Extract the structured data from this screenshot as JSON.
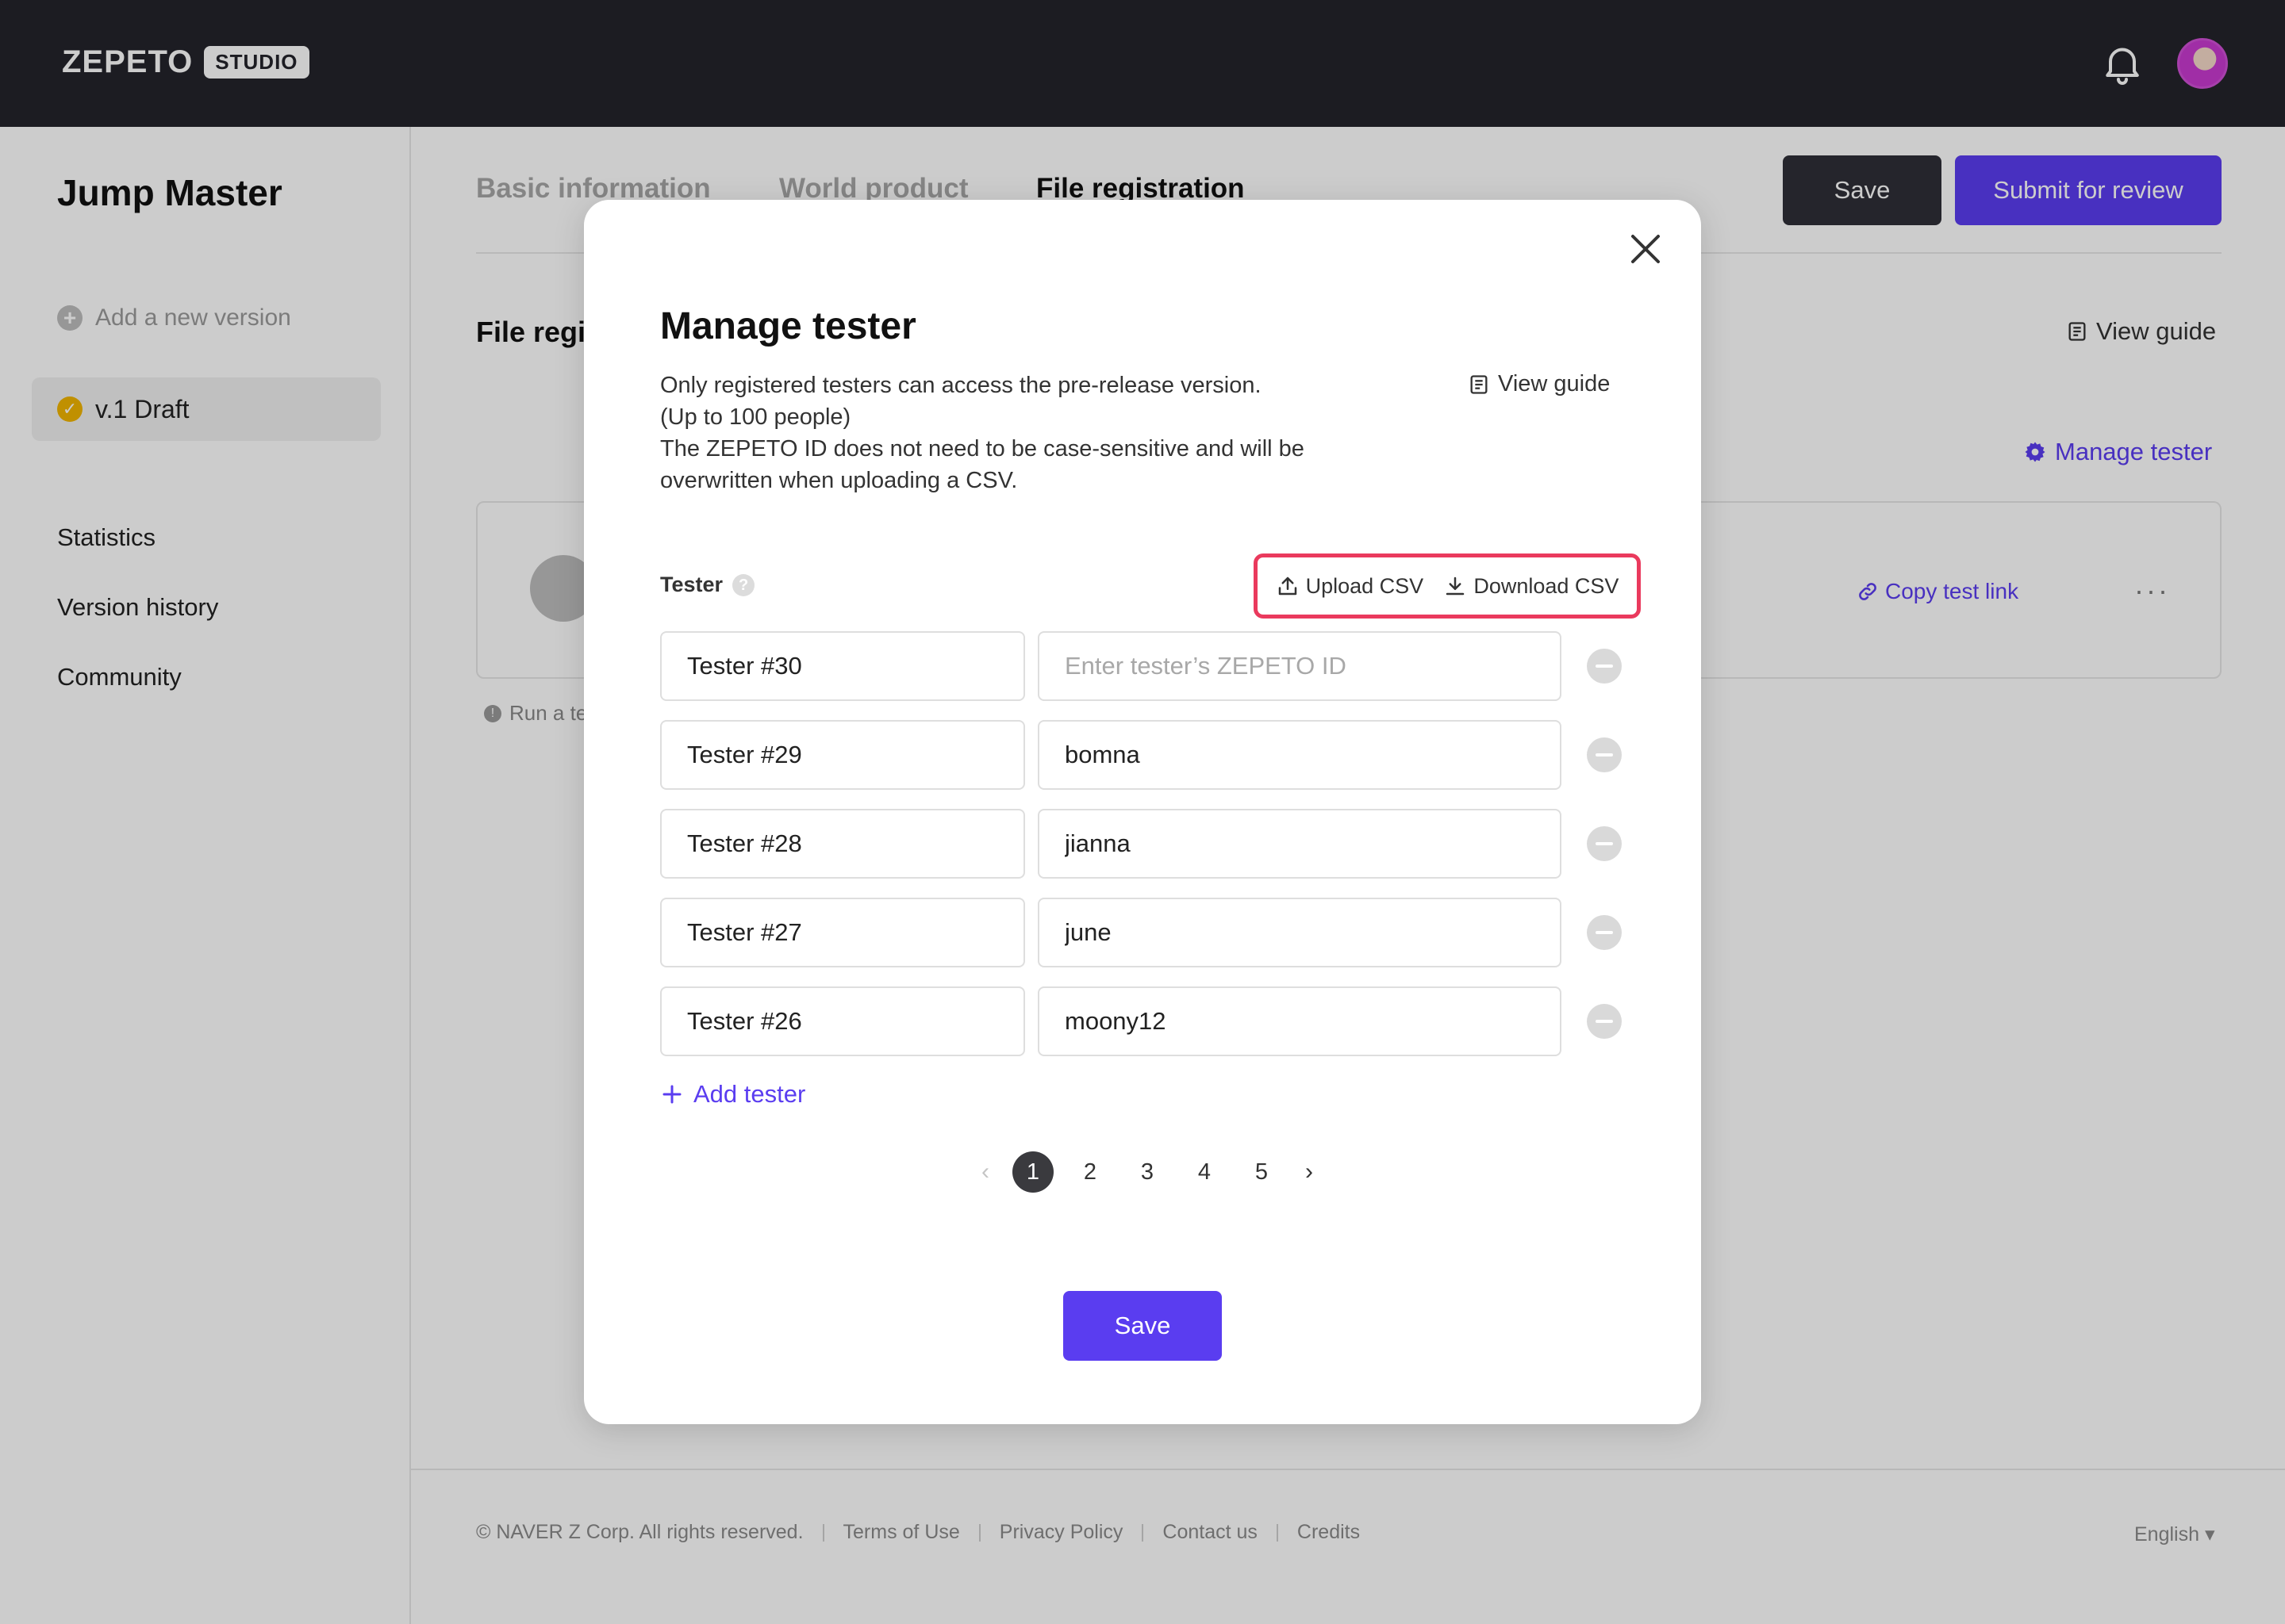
{
  "header": {
    "logo_text": "ZEPETO",
    "logo_badge": "STUDIO"
  },
  "sidebar": {
    "project_title": "Jump Master",
    "add_version": "Add a new version",
    "version_item": "v.1 Draft",
    "nav": [
      "Statistics",
      "Version history",
      "Community"
    ]
  },
  "main": {
    "tabs": [
      "Basic information",
      "World product",
      "File registration"
    ],
    "active_tab": "File registration",
    "save_label": "Save",
    "submit_label": "Submit for review",
    "section_title": "File regi",
    "view_guide": "View guide",
    "manage_tester": "Manage tester",
    "copy_test_link": "Copy test link",
    "more": "···",
    "run_note": "Run a te"
  },
  "footer": {
    "copyright": "© NAVER Z Corp. All rights reserved.",
    "links": [
      "Terms of Use",
      "Privacy Policy",
      "Contact us",
      "Credits"
    ],
    "language": "English ▾"
  },
  "modal": {
    "title": "Manage tester",
    "description": [
      "Only registered testers can access the pre-release version.",
      "(Up to 100 people)",
      "The ZEPETO ID does not need to be case-sensitive and will be",
      "overwritten when uploading a CSV."
    ],
    "view_guide": "View guide",
    "tester_label": "Tester",
    "help": "?",
    "upload_csv": "Upload CSV",
    "download_csv": "Download CSV",
    "id_placeholder": "Enter tester’s ZEPETO ID",
    "testers": [
      {
        "name": "Tester #30",
        "id": ""
      },
      {
        "name": "Tester #29",
        "id": "bomna"
      },
      {
        "name": "Tester #28",
        "id": "jianna"
      },
      {
        "name": "Tester #27",
        "id": "june"
      },
      {
        "name": "Tester #26",
        "id": "moony12"
      }
    ],
    "add_tester": "Add tester",
    "pagination": {
      "pages": [
        "1",
        "2",
        "3",
        "4",
        "5"
      ],
      "current": "1",
      "prev": "‹",
      "next": "›"
    },
    "save_label": "Save"
  },
  "colors": {
    "accent": "#5a3df0",
    "highlight": "#ea3a5d",
    "topbar": "#23232b"
  }
}
